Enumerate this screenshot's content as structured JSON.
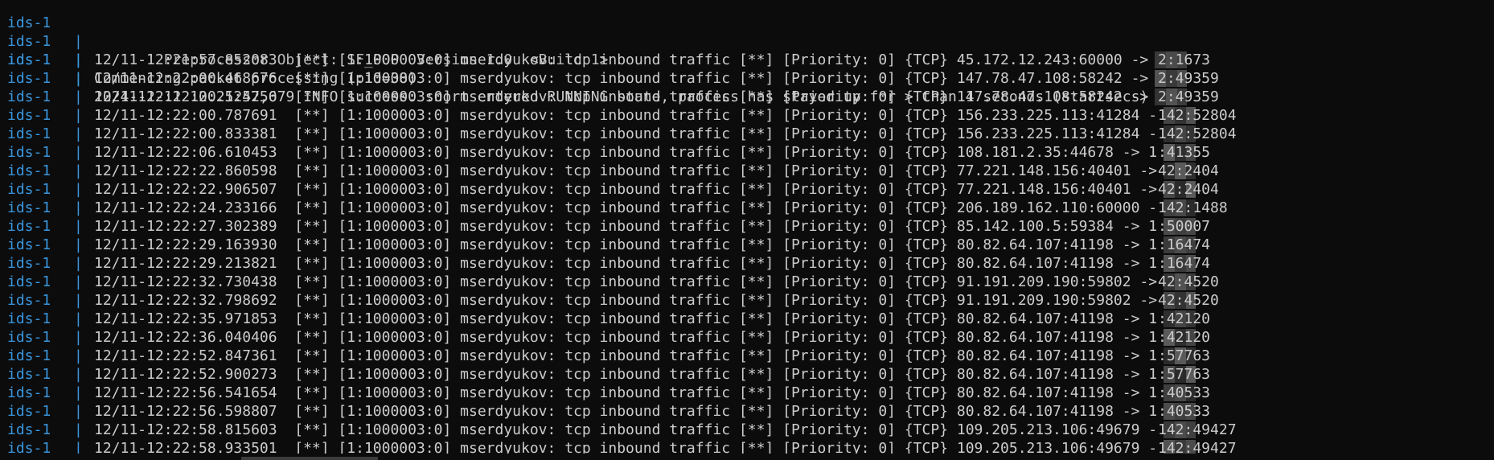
{
  "terminal": {
    "service": "ids-1",
    "separator": "|",
    "header_lines": [
      "        Preprocessor Object: SF_POP  Version 1.0  <Build 1>",
      "Commencing packet processing (pid=38)",
      "2024-12-11 12:21:57,079 INFO success: snort entered RUNNING state, process has stayed up for > than 1 seconds (startsecs)"
    ],
    "alert_lines": [
      {
        "msg": "12/11-12:21:57.852083  [**] [1:1000003:0] mserdyukov: tcp inbound traffic [**] [Priority: 0] {TCP} 45.172.12.243:60000 ->",
        "tail": "2:1673"
      },
      {
        "msg": "12/11-12:22:00.468676  [**] [1:1000003:0] mserdyukov: tcp inbound traffic [**] [Priority: 0] {TCP} 147.78.47.108:58242 ->",
        "tail": "2:49359"
      },
      {
        "msg": "12/11-12:22:00.524256  [**] [1:1000003:0] mserdyukov: tcp inbound traffic [**] [Priority: 0] {TCP} 147.78.47.108:58242 ->",
        "tail": "2:49359"
      },
      {
        "msg": "12/11-12:22:00.787691  [**] [1:1000003:0] mserdyukov: tcp inbound traffic [**] [Priority: 0] {TCP} 156.233.225.113:41284 -",
        "tail": "142:52804"
      },
      {
        "msg": "12/11-12:22:00.833381  [**] [1:1000003:0] mserdyukov: tcp inbound traffic [**] [Priority: 0] {TCP} 156.233.225.113:41284 -",
        "tail": "142:52804"
      },
      {
        "msg": "12/11-12:22:06.610453  [**] [1:1000003:0] mserdyukov: tcp inbound traffic [**] [Priority: 0] {TCP} 108.181.2.35:44678 -> 1",
        "tail": ":41355"
      },
      {
        "msg": "12/11-12:22:22.860598  [**] [1:1000003:0] mserdyukov: tcp inbound traffic [**] [Priority: 0] {TCP} 77.221.148.156:40401 ->",
        "tail": "42:2404"
      },
      {
        "msg": "12/11-12:22:22.906507  [**] [1:1000003:0] mserdyukov: tcp inbound traffic [**] [Priority: 0] {TCP} 77.221.148.156:40401 ->",
        "tail": "42:2404"
      },
      {
        "msg": "12/11-12:22:24.233166  [**] [1:1000003:0] mserdyukov: tcp inbound traffic [**] [Priority: 0] {TCP} 206.189.162.110:60000 -",
        "tail": "142:1488"
      },
      {
        "msg": "12/11-12:22:27.302389  [**] [1:1000003:0] mserdyukov: tcp inbound traffic [**] [Priority: 0] {TCP} 85.142.100.5:59384 -> 1",
        "tail": ":50007"
      },
      {
        "msg": "12/11-12:22:29.163930  [**] [1:1000003:0] mserdyukov: tcp inbound traffic [**] [Priority: 0] {TCP} 80.82.64.107:41198 -> 1",
        "tail": ":16474"
      },
      {
        "msg": "12/11-12:22:29.213821  [**] [1:1000003:0] mserdyukov: tcp inbound traffic [**] [Priority: 0] {TCP} 80.82.64.107:41198 -> 1",
        "tail": ":16474"
      },
      {
        "msg": "12/11-12:22:32.730438  [**] [1:1000003:0] mserdyukov: tcp inbound traffic [**] [Priority: 0] {TCP} 91.191.209.190:59802 ->",
        "tail": "42:4520"
      },
      {
        "msg": "12/11-12:22:32.798692  [**] [1:1000003:0] mserdyukov: tcp inbound traffic [**] [Priority: 0] {TCP} 91.191.209.190:59802 ->",
        "tail": "42:4520"
      },
      {
        "msg": "12/11-12:22:35.971853  [**] [1:1000003:0] mserdyukov: tcp inbound traffic [**] [Priority: 0] {TCP} 80.82.64.107:41198 -> 1",
        "tail": ":42120"
      },
      {
        "msg": "12/11-12:22:36.040406  [**] [1:1000003:0] mserdyukov: tcp inbound traffic [**] [Priority: 0] {TCP} 80.82.64.107:41198 -> 1",
        "tail": ":42120"
      },
      {
        "msg": "12/11-12:22:52.847361  [**] [1:1000003:0] mserdyukov: tcp inbound traffic [**] [Priority: 0] {TCP} 80.82.64.107:41198 -> 1",
        "tail": ":57763"
      },
      {
        "msg": "12/11-12:22:52.900273  [**] [1:1000003:0] mserdyukov: tcp inbound traffic [**] [Priority: 0] {TCP} 80.82.64.107:41198 -> 1",
        "tail": ":57763"
      },
      {
        "msg": "12/11-12:22:56.541654  [**] [1:1000003:0] mserdyukov: tcp inbound traffic [**] [Priority: 0] {TCP} 80.82.64.107:41198 -> 1",
        "tail": ":40533"
      },
      {
        "msg": "12/11-12:22:56.598807  [**] [1:1000003:0] mserdyukov: tcp inbound traffic [**] [Priority: 0] {TCP} 80.82.64.107:41198 -> 1",
        "tail": ":40533"
      },
      {
        "msg": "12/11-12:22:58.815603  [**] [1:1000003:0] mserdyukov: tcp inbound traffic [**] [Priority: 0] {TCP} 109.205.213.106:49679 -",
        "tail": "142:49427"
      },
      {
        "msg": "12/11-12:22:58.933501  [**] [1:1000003:0] mserdyukov: tcp inbound traffic [**] [Priority: 0] {TCP} 109.205.213.106:49679 -",
        "tail": "142:49427"
      }
    ],
    "colors": {
      "background": "#0c0c0c",
      "service_prefix": "#3a96dd",
      "text": "#cccccc"
    }
  }
}
